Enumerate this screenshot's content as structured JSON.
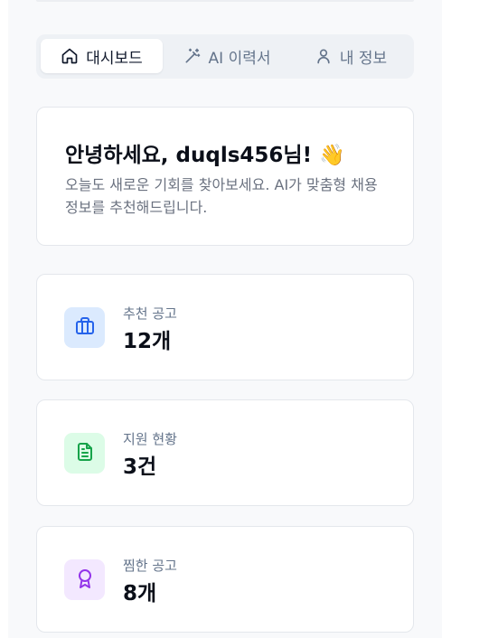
{
  "tabs": [
    {
      "label": "대시보드",
      "icon": "home-icon",
      "active": true
    },
    {
      "label": "AI 이력서",
      "icon": "magic-wand-icon",
      "active": false
    },
    {
      "label": "내 정보",
      "icon": "user-icon",
      "active": false
    }
  ],
  "welcome": {
    "title": "안녕하세요, duqls456님!",
    "emoji": "👋",
    "subtitle": "오늘도 새로운 기회를 찾아보세요. AI가 맞춤형 채용정보를 추천해드립니다."
  },
  "stats": [
    {
      "label": "추천 공고",
      "value": "12개",
      "icon": "briefcase-icon",
      "color": "#2563eb",
      "bg": "#dbeafe"
    },
    {
      "label": "지원 현황",
      "value": "3건",
      "icon": "document-icon",
      "color": "#16a34a",
      "bg": "#dcfce7"
    },
    {
      "label": "찜한 공고",
      "value": "8개",
      "icon": "award-icon",
      "color": "#9333ea",
      "bg": "#f3e8ff"
    }
  ]
}
